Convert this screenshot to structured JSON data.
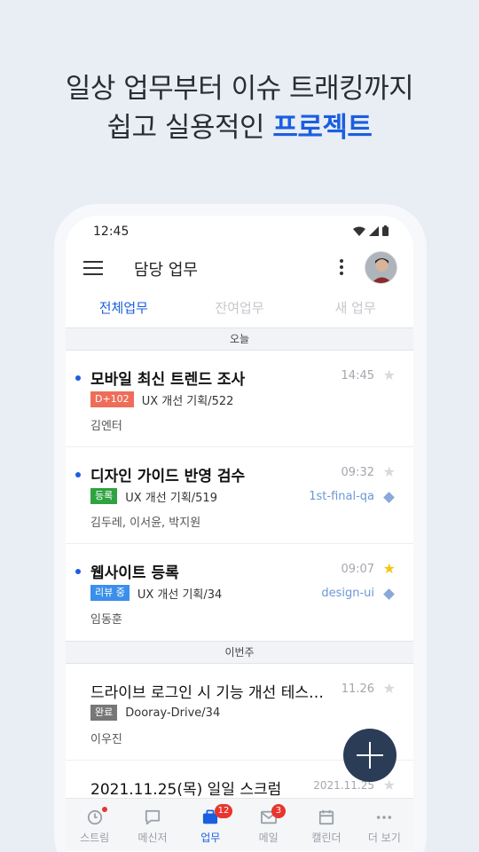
{
  "headline": {
    "line1": "일상 업무부터 이슈 트래킹까지",
    "line2_prefix": "쉽고 실용적인 ",
    "line2_accent": "프로젝트"
  },
  "status_bar": {
    "time": "12:45"
  },
  "app_bar": {
    "title": "담당 업무",
    "menu_icon": "hamburger-menu-icon",
    "more_icon": "kebab-more-icon"
  },
  "tabs": [
    {
      "label": "전체업무",
      "active": true
    },
    {
      "label": "잔여업무",
      "active": false
    },
    {
      "label": "새 업무",
      "active": false
    }
  ],
  "sections": [
    {
      "label": "오늘",
      "tasks": [
        {
          "title": "모바일 최신 트렌드 조사",
          "time": "14:45",
          "starred": false,
          "badge": "D+102",
          "project": "UX 개선 기획/522",
          "tag": "",
          "assignees": "김엔터",
          "unread": true
        },
        {
          "title": "디자인 가이드 반영 검수",
          "time": "09:32",
          "starred": false,
          "badge": "등록",
          "project": "UX 개선 기획/519",
          "tag": "1st-final-qa",
          "assignees": "김두레, 이서윤, 박지원",
          "unread": true
        },
        {
          "title": "웹사이트 등록",
          "time": "09:07",
          "starred": true,
          "badge": "리뷰 중",
          "project": "UX 개선 기획/34",
          "tag": "design-ui",
          "assignees": "임동훈",
          "unread": true
        }
      ]
    },
    {
      "label": "이번주",
      "tasks": [
        {
          "title": "드라이브 로그인 시 기능 개선 테스…",
          "time": "11.26",
          "starred": false,
          "badge": "완료",
          "project": "Dooray-Drive/34",
          "tag": "",
          "assignees": "이우진",
          "unread": false
        },
        {
          "title": "2021.11.25(목) 일일 스크럼",
          "time": "2021.11.25",
          "starred": false,
          "badge": "",
          "project": "",
          "tag": "",
          "assignees": "",
          "unread": false
        }
      ]
    }
  ],
  "bottom_nav": [
    {
      "label": "스트림",
      "icon": "clock-icon",
      "badge": "",
      "dot": true,
      "active": false
    },
    {
      "label": "메신저",
      "icon": "chat-bubble-icon",
      "badge": "",
      "dot": false,
      "active": false
    },
    {
      "label": "업무",
      "icon": "briefcase-icon",
      "badge": "12",
      "dot": false,
      "active": true
    },
    {
      "label": "메일",
      "icon": "mail-icon",
      "badge": "3",
      "dot": false,
      "active": false
    },
    {
      "label": "캘린더",
      "icon": "calendar-icon",
      "badge": "",
      "dot": false,
      "active": false
    },
    {
      "label": "더 보기",
      "icon": "more-dots-icon",
      "badge": "",
      "dot": false,
      "active": false
    }
  ],
  "colors": {
    "accent": "#1a5fe0",
    "fab": "#2b3c57",
    "star_on": "#f5c518",
    "badge_red": "#ee6d5a",
    "badge_green": "#2ea340",
    "badge_blue": "#3b8fea",
    "badge_gray": "#777777"
  }
}
